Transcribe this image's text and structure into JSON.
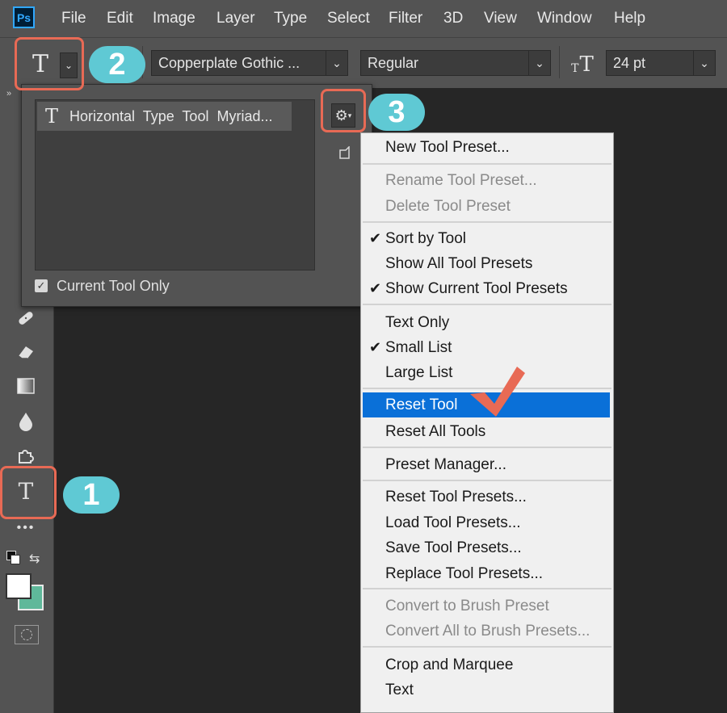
{
  "app": {
    "logo_text": "Ps"
  },
  "menubar": {
    "items": [
      "File",
      "Edit",
      "Image",
      "Layer",
      "Type",
      "Select",
      "Filter",
      "3D",
      "View",
      "Window",
      "Help"
    ]
  },
  "options": {
    "tool_glyph": "T",
    "font_family": "Copperplate Gothic ...",
    "font_style": "Regular",
    "font_size": "24 pt",
    "size_icon_glyph": "T"
  },
  "preset_picker": {
    "preset_name": "Horizontal  Type  Tool  Myriad...",
    "current_tool_only_label": "Current Tool Only",
    "current_tool_only_checked": true
  },
  "badges": {
    "one": "1",
    "two": "2",
    "three": "3"
  },
  "context_menu": {
    "items": [
      {
        "label": "New Tool Preset...",
        "enabled": true,
        "checked": false
      },
      {
        "label": "Rename Tool Preset...",
        "enabled": false,
        "checked": false
      },
      {
        "label": "Delete Tool Preset",
        "enabled": false,
        "checked": false
      },
      {
        "label": "Sort by Tool",
        "enabled": true,
        "checked": true
      },
      {
        "label": "Show All Tool Presets",
        "enabled": true,
        "checked": false
      },
      {
        "label": "Show Current Tool Presets",
        "enabled": true,
        "checked": true
      },
      {
        "label": "Text Only",
        "enabled": true,
        "checked": false
      },
      {
        "label": "Small List",
        "enabled": true,
        "checked": true
      },
      {
        "label": "Large List",
        "enabled": true,
        "checked": false
      },
      {
        "label": "Reset Tool",
        "enabled": true,
        "checked": false,
        "selected": true
      },
      {
        "label": "Reset All Tools",
        "enabled": true,
        "checked": false
      },
      {
        "label": "Preset Manager...",
        "enabled": true,
        "checked": false
      },
      {
        "label": "Reset Tool Presets...",
        "enabled": true,
        "checked": false
      },
      {
        "label": "Load Tool Presets...",
        "enabled": true,
        "checked": false
      },
      {
        "label": "Save Tool Presets...",
        "enabled": true,
        "checked": false
      },
      {
        "label": "Replace Tool Presets...",
        "enabled": true,
        "checked": false
      },
      {
        "label": "Convert to Brush Preset",
        "enabled": false,
        "checked": false
      },
      {
        "label": "Convert All to Brush Presets...",
        "enabled": false,
        "checked": false
      },
      {
        "label": "Crop and Marquee",
        "enabled": true,
        "checked": false
      },
      {
        "label": "Text",
        "enabled": true,
        "checked": false
      }
    ]
  },
  "colors": {
    "highlight": "#e86a55",
    "badge": "#5fc9d4",
    "selection": "#0a70d8",
    "background_swatch": "#5fb89a"
  }
}
